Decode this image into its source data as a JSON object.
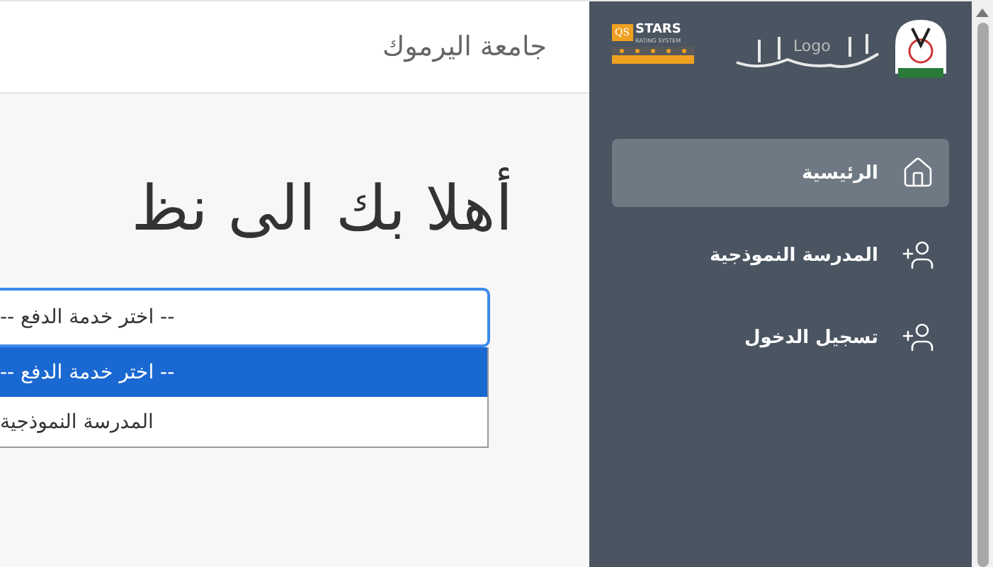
{
  "header": {
    "title": "جامعة اليرموك"
  },
  "logo": {
    "alt_text": "Logo",
    "badge": {
      "brand": "QS",
      "name": "STARS",
      "tagline": "RATING SYSTEM"
    }
  },
  "welcome": {
    "heading": "أهلا بك الى نظ"
  },
  "payment_select": {
    "value": "-- اختر خدمة الدفع --",
    "expanded": true,
    "options": [
      {
        "label": "-- اختر خدمة الدفع --",
        "selected": true
      },
      {
        "label": "المدرسة النموذجية",
        "selected": false
      }
    ]
  },
  "sidebar": {
    "items": [
      {
        "label": "الرئيسية",
        "kind": "home",
        "selected": true
      },
      {
        "label": "المدرسة النموذجية",
        "kind": "user-add",
        "selected": false
      },
      {
        "label": "تسجيل الدخول",
        "kind": "user-add",
        "selected": false
      }
    ]
  }
}
